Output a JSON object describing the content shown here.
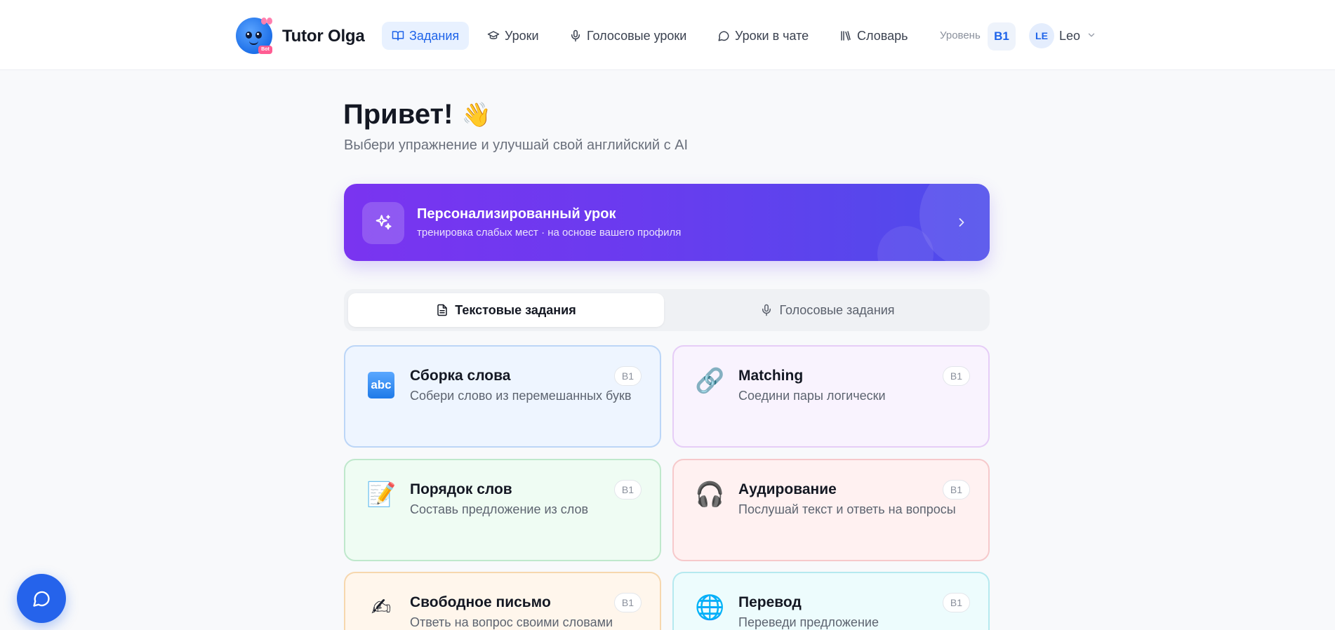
{
  "header": {
    "brand": "Tutor Olga",
    "logo_tag": "Bot",
    "nav": [
      {
        "label": "Задания",
        "icon": "book-open-icon",
        "active": true
      },
      {
        "label": "Уроки",
        "icon": "graduation-cap-icon",
        "active": false
      },
      {
        "label": "Голосовые уроки",
        "icon": "microphone-icon",
        "active": false
      },
      {
        "label": "Уроки в чате",
        "icon": "chat-bubble-icon",
        "active": false
      },
      {
        "label": "Словарь",
        "icon": "library-icon",
        "active": false
      }
    ],
    "level_label": "Уровень",
    "level": "B1",
    "user_initials": "LE",
    "user_name": "Leo"
  },
  "main": {
    "greeting": "Привет!",
    "greeting_emoji": "👋",
    "subtitle": "Выбери упражнение и улучшай свой английский с AI",
    "promo": {
      "title": "Персонализированный урок",
      "subtitle": "тренировка слабых мест · на основе вашего профиля",
      "icon": "sparkles-icon"
    },
    "tabs": [
      {
        "label": "Текстовые задания",
        "icon": "document-icon",
        "active": true
      },
      {
        "label": "Голосовые задания",
        "icon": "microphone-icon",
        "active": false
      }
    ],
    "cards": [
      {
        "title": "Сборка слова",
        "desc": "Собери слово из перемешанных букв",
        "badge": "B1",
        "icon": "abc-icon",
        "icon_text": "abc",
        "bg": "#eef5ff",
        "border": "#bcd6f7"
      },
      {
        "title": "Matching",
        "desc": "Соедини пары логически",
        "badge": "B1",
        "icon": "link-icon",
        "icon_text": "🔗",
        "bg": "#f9f3fe",
        "border": "#e6cdf7"
      },
      {
        "title": "Порядок слов",
        "desc": "Составь предложение из слов",
        "badge": "B1",
        "icon": "memo-icon",
        "icon_text": "📝",
        "bg": "#effcf3",
        "border": "#bfe8cc"
      },
      {
        "title": "Аудирование",
        "desc": "Послушай текст и ответь на вопросы",
        "badge": "B1",
        "icon": "headphones-icon",
        "icon_text": "🎧",
        "bg": "#fff1f1",
        "border": "#f6c9cb"
      },
      {
        "title": "Свободное письмо",
        "desc": "Ответь на вопрос своими словами",
        "badge": "B1",
        "icon": "writing-hand-icon",
        "icon_text": "✍",
        "bg": "#fff6ec",
        "border": "#f6d7ae"
      },
      {
        "title": "Перевод",
        "desc": "Переведи предложение",
        "badge": "B1",
        "icon": "globe-icon",
        "icon_text": "🌐",
        "bg": "#edfcfd",
        "border": "#b5e9ef"
      }
    ]
  },
  "colors": {
    "accent": "#2563eb",
    "promo_start": "#7a34f0",
    "promo_end": "#4e4ceb"
  }
}
